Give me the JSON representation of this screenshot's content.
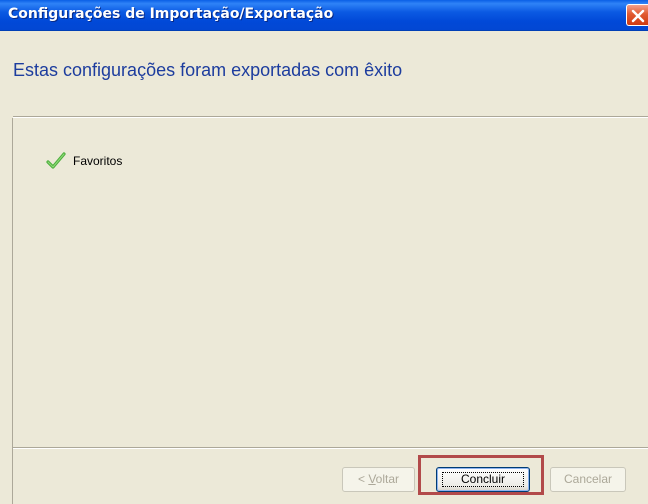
{
  "window": {
    "title": "Configurações de Importação/Exportação"
  },
  "header": {
    "message": "Estas configurações foram exportadas com êxito"
  },
  "items": [
    {
      "label": "Favoritos",
      "status_icon": "check-icon",
      "status_color": "#4caf3c"
    }
  ],
  "buttons": {
    "back_prefix": "< ",
    "back_mnemonic": "V",
    "back_rest": "oltar",
    "finish": "Concluir",
    "cancel": "Cancelar"
  },
  "colors": {
    "titlebar": "#0149d8",
    "header_text": "#1d3d9e",
    "highlight": "#b24a4a",
    "close": "#e15a31"
  }
}
